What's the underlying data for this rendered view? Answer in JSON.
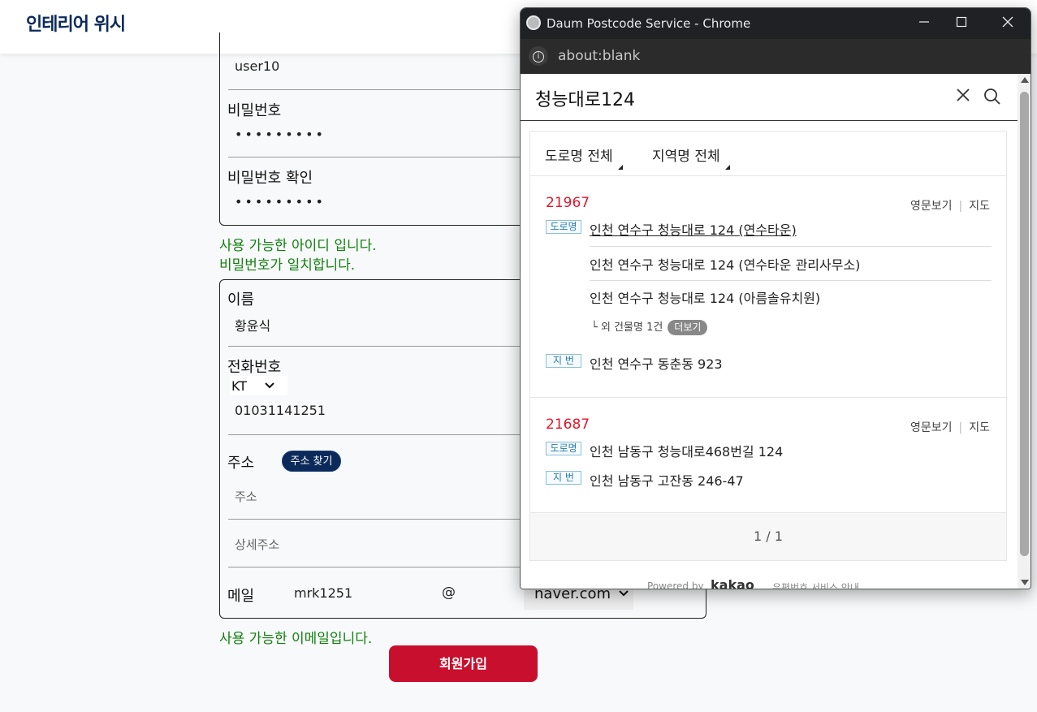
{
  "header": {
    "logo": "인테리어 위시"
  },
  "form": {
    "user_id": "user10",
    "password_label": "비밀번호",
    "password_mask": "•••••••••",
    "password_confirm_label": "비밀번호 확인",
    "password_confirm_mask": "•••••••••",
    "id_message": "사용 가능한 아이디 입니다.",
    "pw_message": "비밀번호가 일치합니다.",
    "name_label": "이름",
    "name_value": "황윤식",
    "phone_label": "전화번호",
    "carrier": "KT",
    "phone_value": "01031141251",
    "address_label": "주소",
    "address_search_button": "주소 찾기",
    "address_placeholder": "주소",
    "detail_address_placeholder": "상세주소",
    "email_label": "메일",
    "email_id": "mrk1251",
    "email_at": "@",
    "email_domain": "naver.com",
    "email_message": "사용 가능한 이메일입니다.",
    "signup_button": "회원가입"
  },
  "popup": {
    "window_title": "Daum Postcode Service - Chrome",
    "url": "about:blank",
    "search_query": "청능대로124",
    "filters": [
      "도로명 전체",
      "지역명 전체"
    ],
    "results": [
      {
        "zip": "21967",
        "english_link": "영문보기",
        "map_link": "지도",
        "road_tag": "도로명",
        "road_addresses": [
          "인천 연수구 청능대로 124 (연수타운)",
          "인천 연수구 청능대로 124 (연수타운 관리사무소)",
          "인천 연수구 청능대로 124 (아름솔유치원)"
        ],
        "more_text": "└ 외 건물명 1건",
        "more_button": "더보기",
        "jibun_tag": "지 번",
        "jibun_address": "인천 연수구 동춘동 923"
      },
      {
        "zip": "21687",
        "english_link": "영문보기",
        "map_link": "지도",
        "road_tag": "도로명",
        "road_address": "인천 남동구 청능대로468번길 124",
        "jibun_tag": "지 번",
        "jibun_address": "인천 남동구 고잔동 246-47"
      }
    ],
    "pagination": "1 / 1",
    "footer": {
      "powered_by": "Powered by",
      "brand": "kakao",
      "guide": "우편번호 서비스 안내"
    }
  }
}
